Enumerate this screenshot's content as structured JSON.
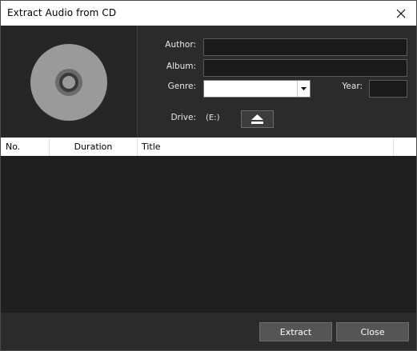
{
  "window": {
    "title": "Extract Audio from CD"
  },
  "info": {
    "author_label": "Author:",
    "author_value": "",
    "album_label": "Album:",
    "album_value": "",
    "genre_label": "Genre:",
    "genre_value": "",
    "year_label": "Year:",
    "year_value": "",
    "drive_label": "Drive:",
    "drive_value": "(E:)"
  },
  "table": {
    "columns": [
      "No.",
      "Duration",
      "Title"
    ],
    "rows": []
  },
  "footer": {
    "extract_label": "Extract",
    "close_label": "Close"
  },
  "colors": {
    "window_bg": "#1f1f1f",
    "panel_bg": "#2b2b2b",
    "disc_gray": "#9a9a9a",
    "button_bg": "#555555"
  },
  "icons": {
    "close": "close-icon",
    "cd": "cd-disc-icon",
    "dropdown": "chevron-down-icon",
    "eject": "eject-icon"
  }
}
